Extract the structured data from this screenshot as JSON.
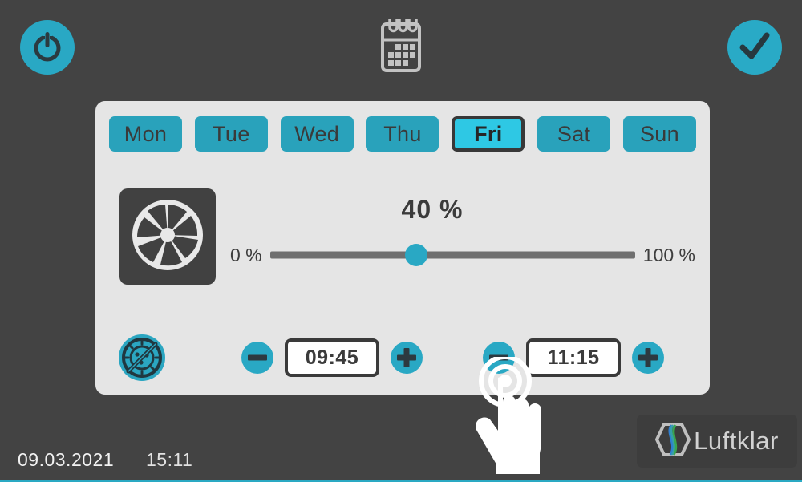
{
  "header": {
    "power_button": {
      "icon": "power-icon",
      "label": "Power"
    },
    "calendar_button": {
      "icon": "calendar-icon",
      "label": "Schedule"
    },
    "confirm_button": {
      "icon": "checkmark-icon",
      "label": "Confirm"
    }
  },
  "days": [
    {
      "label": "Mon",
      "selected": false
    },
    {
      "label": "Tue",
      "selected": false
    },
    {
      "label": "Wed",
      "selected": false
    },
    {
      "label": "Thu",
      "selected": false
    },
    {
      "label": "Fri",
      "selected": true
    },
    {
      "label": "Sat",
      "selected": false
    },
    {
      "label": "Sun",
      "selected": false
    }
  ],
  "fan": {
    "icon": "fan-icon",
    "value_label": "40 %",
    "percent": 40,
    "min_label": "0 %",
    "max_label": "100 %",
    "min": 0,
    "max": 100
  },
  "uv": {
    "icon": "antibacterial-icon"
  },
  "schedule": {
    "start": {
      "time": "09:45",
      "decrement_label": "−",
      "increment_label": "+"
    },
    "end": {
      "time": "11:15",
      "decrement_label": "−",
      "increment_label": "+"
    }
  },
  "cursor": {
    "icon": "touch-hand-icon"
  },
  "status": {
    "date": "09.03.2021",
    "time": "15:11"
  },
  "brand": {
    "name": "Luftklar",
    "icon": "luftklar-logo-icon"
  },
  "colors": {
    "background": "#434343",
    "panel": "#e5e5e5",
    "accent_teal": "#29a8c4",
    "accent_cyan_selected": "#2ec8e4",
    "dark_text": "#3b3b3b",
    "track_gray": "#6f6f6f",
    "status_text": "#f2f2f2"
  }
}
